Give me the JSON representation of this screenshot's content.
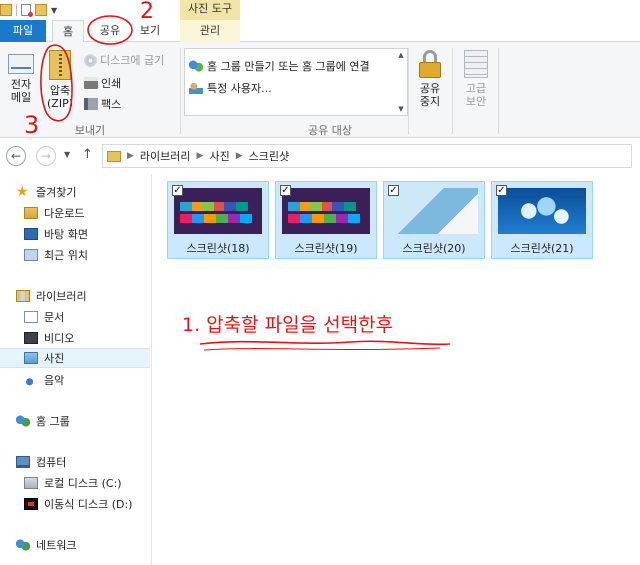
{
  "contextual_tab": "사진 도구",
  "tabs": {
    "file": "파일",
    "home": "홈",
    "share": "공유",
    "view": "보기",
    "manage": "관리"
  },
  "ribbon": {
    "send_group": {
      "email_label_line1": "전자",
      "email_label_line2": "메일",
      "zip_label_line1": "압축",
      "zip_label_line2": "(ZIP)",
      "burn_label": "디스크에 굽기",
      "print_label": "인쇄",
      "fax_label": "팩스",
      "group_label": "보내기"
    },
    "share_group": {
      "items": [
        "홈 그룹 만들기 또는 홈 그룹에 연결",
        "특정 사용자..."
      ],
      "group_label": "공유 대상"
    },
    "stop_share_line1": "공유",
    "stop_share_line2": "중지",
    "advanced_line1": "고급",
    "advanced_line2": "보안"
  },
  "address": {
    "crumbs": [
      "라이브러리",
      "사진",
      "스크린샷"
    ]
  },
  "navpane": {
    "favorites": "즐겨찾기",
    "downloads": "다운로드",
    "desktop": "바탕 화면",
    "recent": "최근 위치",
    "libraries": "라이브러리",
    "documents": "문서",
    "videos": "비디오",
    "pictures": "사진",
    "music": "음악",
    "homegroup": "홈 그룹",
    "computer": "컴퓨터",
    "local_disk": "로컬 디스크 (C:)",
    "removable_disk": "이동식 디스크 (D:)",
    "network": "네트워크"
  },
  "files": [
    {
      "name": "스크린샷(18)",
      "checked": true
    },
    {
      "name": "스크린샷(19)",
      "checked": true
    },
    {
      "name": "스크린샷(20)",
      "checked": true
    },
    {
      "name": "스크린샷(21)",
      "checked": true
    }
  ],
  "annotations": {
    "step1": "1. 압축할 파일을 선택한후",
    "step2": "2",
    "step3": "3"
  },
  "colors": {
    "file_tab": "#1979ca",
    "selection": "#cce8ff",
    "annotation": "#e01616"
  }
}
